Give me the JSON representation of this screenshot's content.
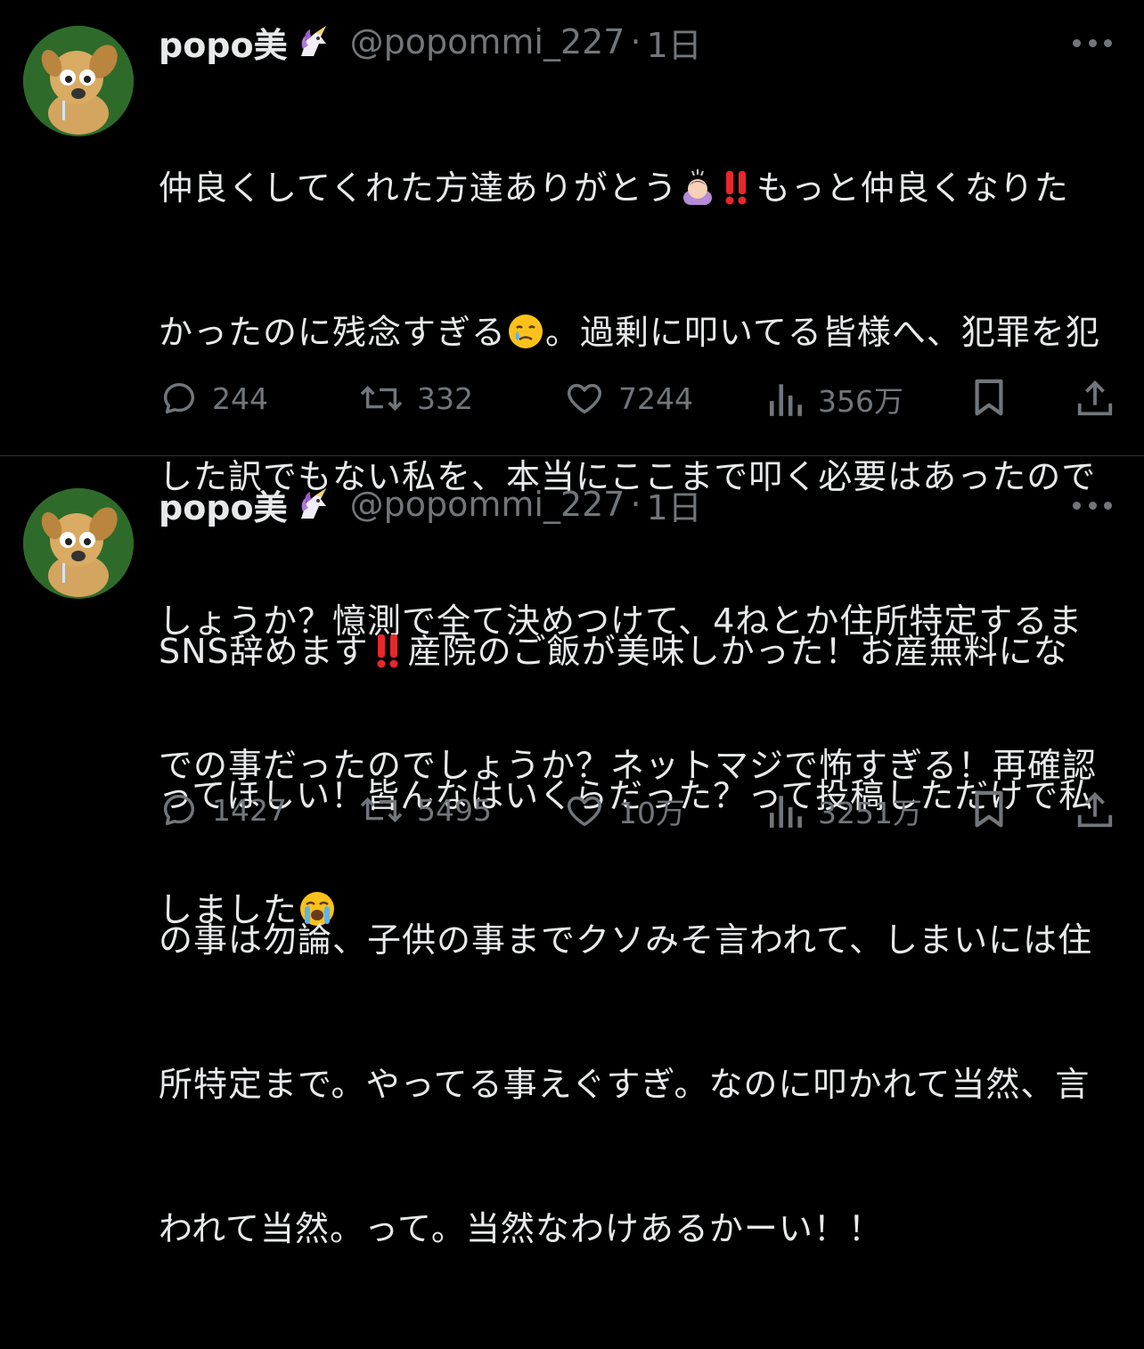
{
  "colors": {
    "background": "#000000",
    "text": "#e7e9ea",
    "muted": "#71767b",
    "like_red": "#e0245e"
  },
  "tweets": [
    {
      "name": "popo美",
      "handle": "@popommi_227",
      "separator": "·",
      "time": "1日",
      "line1a": "仲良くしてくれた方達ありがとう",
      "line1b": "もっと仲良くなりた",
      "line2a": "かったのに残念すぎる",
      "line2b": "。過剰に叩いてる皆様へ、犯罪を犯",
      "line3": "した訳でもない私を、本当にここまで叩く必要はあったので",
      "line4": "しょうか？憶測で全て決めつけて、4ねとか住所特定するま",
      "line5": "での事だったのでしょうか？ネットマジで怖すぎる！再確認",
      "line6": "しました",
      "replies": "244",
      "retweets": "332",
      "likes": "7244",
      "views": "356万"
    },
    {
      "name": "popo美",
      "handle": "@popommi_227",
      "separator": "·",
      "time": "1日",
      "line1a": "SNS辞めます",
      "line1b": "産院のご飯が美味しかった！お産無料にな",
      "line2": "ってほしい！皆んなはいくらだった？って投稿しただけで私",
      "line3": "の事は勿論、子供の事までクソみそ言われて、しまいには住",
      "line4": "所特定まで。やってる事えぐすぎ。なのに叩かれて当然、言",
      "line5": "われて当然。って。当然なわけあるかーい！！",
      "replies": "1427",
      "retweets": "5495",
      "likes": "10万",
      "views": "3251万"
    }
  ],
  "icons": [
    "reply-icon",
    "retweet-icon",
    "like-icon",
    "views-icon",
    "bookmark-icon",
    "share-icon",
    "more-icon",
    "unicorn-emoji",
    "bangbang-emoji",
    "bowing-emoji",
    "teary-emoji",
    "crying-emoji"
  ]
}
